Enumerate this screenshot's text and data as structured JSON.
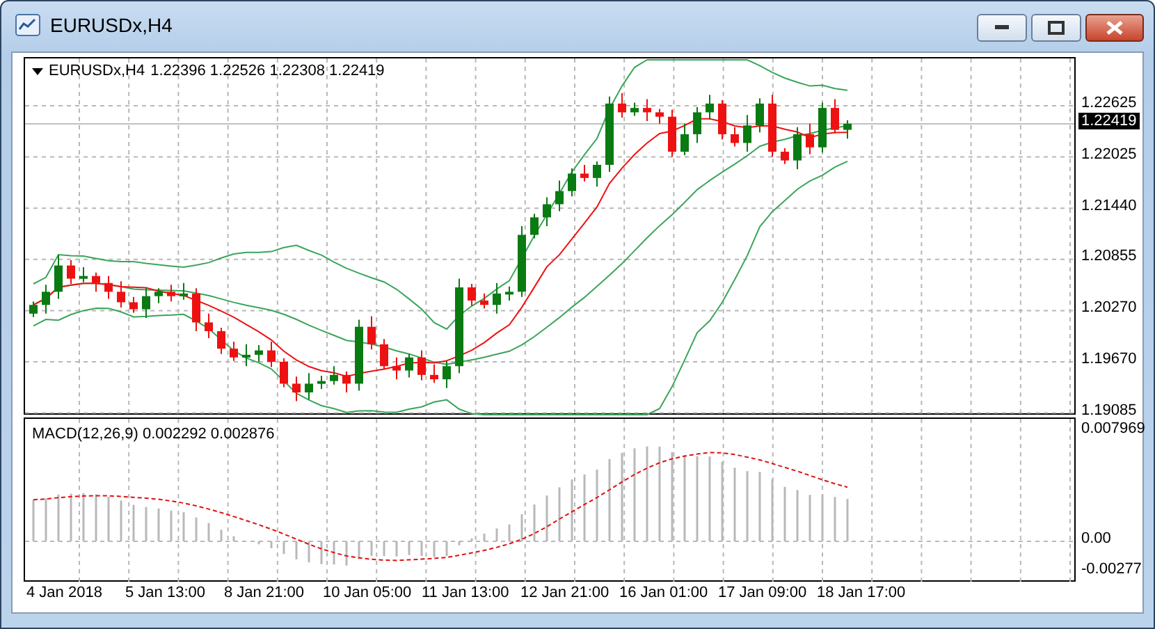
{
  "window": {
    "title": "EURUSDx,H4"
  },
  "legend": {
    "symbol": "EURUSDx,H4",
    "values": "1.22396 1.22526 1.22308 1.22419"
  },
  "price_axis": {
    "labels": [
      "1.22625",
      "1.22025",
      "1.21440",
      "1.20855",
      "1.20270",
      "1.19670",
      "1.19085"
    ],
    "current_price": "1.22419"
  },
  "macd": {
    "legend": "MACD(12,26,9) 0.002292 0.002876",
    "axis_labels": [
      "0.007969",
      "0.00",
      "-0.00277"
    ]
  },
  "time_axis": {
    "labels": [
      "4 Jan 2018",
      "5 Jan 13:00",
      "8 Jan 21:00",
      "10 Jan 05:00",
      "11 Jan 13:00",
      "12 Jan 21:00",
      "16 Jan 01:00",
      "17 Jan 09:00",
      "18 Jan 17:00"
    ]
  }
}
